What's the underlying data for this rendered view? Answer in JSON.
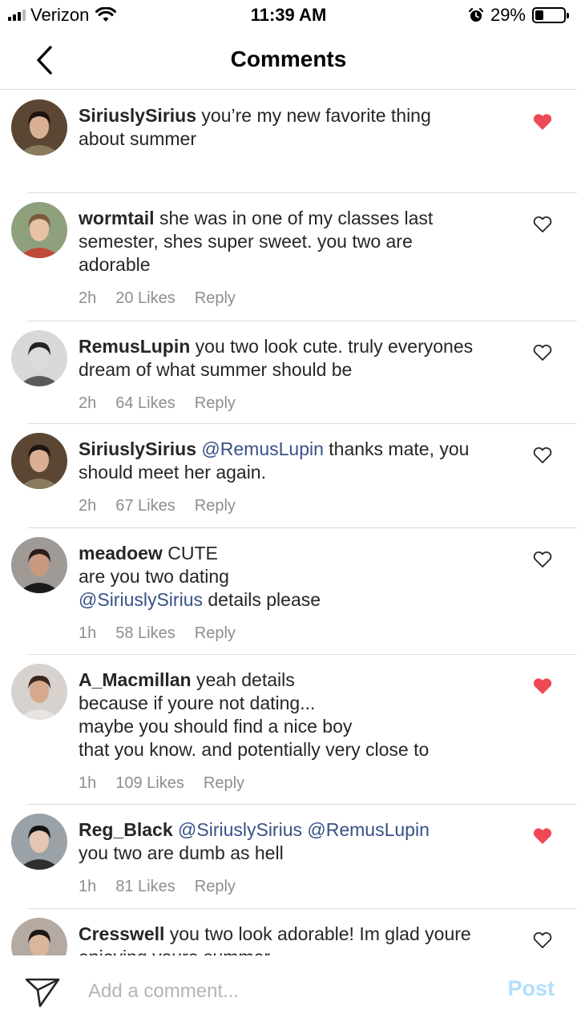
{
  "status_bar": {
    "carrier": "Verizon",
    "time": "11:39 AM",
    "battery": "29%",
    "battery_level": 0.29
  },
  "header": {
    "title": "Comments"
  },
  "comments": [
    {
      "username": "SiriuslySirius",
      "lines": [
        [
          {
            "t": "you’re my new favorite thing",
            "m": false
          }
        ],
        [
          {
            "t": "about summer",
            "m": false
          }
        ]
      ],
      "time": "",
      "likes": "",
      "reply": "",
      "liked": true
    },
    {
      "username": "wormtail",
      "lines": [
        [
          {
            "t": "she was in one of my classes last",
            "m": false
          }
        ],
        [
          {
            "t": "semester, shes super sweet. you two are",
            "m": false
          }
        ],
        [
          {
            "t": "adorable",
            "m": false
          }
        ]
      ],
      "time": "2h",
      "likes": "20 Likes",
      "reply": "Reply",
      "liked": false
    },
    {
      "username": "RemusLupin",
      "lines": [
        [
          {
            "t": "you two look cute. truly everyones",
            "m": false
          }
        ],
        [
          {
            "t": "dream of what summer should be",
            "m": false
          }
        ]
      ],
      "time": "2h",
      "likes": "64 Likes",
      "reply": "Reply",
      "liked": false
    },
    {
      "username": "SiriuslySirius",
      "lines": [
        [
          {
            "t": "@RemusLupin",
            "m": true
          },
          {
            "t": " thanks mate, you",
            "m": false
          }
        ],
        [
          {
            "t": "should meet her again.",
            "m": false
          }
        ]
      ],
      "time": "2h",
      "likes": "67 Likes",
      "reply": "Reply",
      "liked": false
    },
    {
      "username": "meadoew",
      "lines": [
        [
          {
            "t": "CUTE",
            "m": false
          }
        ],
        [
          {
            "t": "are you two dating",
            "m": false
          }
        ],
        [
          {
            "t": "@SiriuslySirius",
            "m": true
          },
          {
            "t": " details please",
            "m": false
          }
        ]
      ],
      "time": "1h",
      "likes": "58 Likes",
      "reply": "Reply",
      "liked": false
    },
    {
      "username": "A_Macmillan",
      "lines": [
        [
          {
            "t": "yeah details",
            "m": false
          }
        ],
        [
          {
            "t": "because if youre not dating...",
            "m": false
          }
        ],
        [
          {
            "t": "maybe you should find a nice boy",
            "m": false
          }
        ],
        [
          {
            "t": "that you know. and potentially very close to",
            "m": false
          }
        ]
      ],
      "time": "1h",
      "likes": "109 Likes",
      "reply": "Reply",
      "liked": true
    },
    {
      "username": "Reg_Black",
      "lines": [
        [
          {
            "t": "@SiriuslySirius",
            "m": true
          },
          {
            "t": "   ",
            "m": false
          },
          {
            "t": "@RemusLupin",
            "m": true
          }
        ],
        [
          {
            "t": "you two are dumb as hell",
            "m": false
          }
        ]
      ],
      "time": "1h",
      "likes": "81 Likes",
      "reply": "Reply",
      "liked": true
    },
    {
      "username": "Cresswell",
      "lines": [
        [
          {
            "t": "you two look adorable! Im glad youre",
            "m": false
          }
        ],
        [
          {
            "t": "enjoying youre summer",
            "m": false
          }
        ]
      ],
      "time": "",
      "likes": "",
      "reply": "",
      "liked": false
    }
  ],
  "composer": {
    "placeholder": "Add a comment...",
    "post_label": "Post"
  },
  "colors": {
    "text": "#262626",
    "mention": "#385185",
    "secondary": "#8e8e8e",
    "heart_liked": "#ed4956",
    "post_disabled": "#b2dffc",
    "divider": "#dbdbdb"
  }
}
